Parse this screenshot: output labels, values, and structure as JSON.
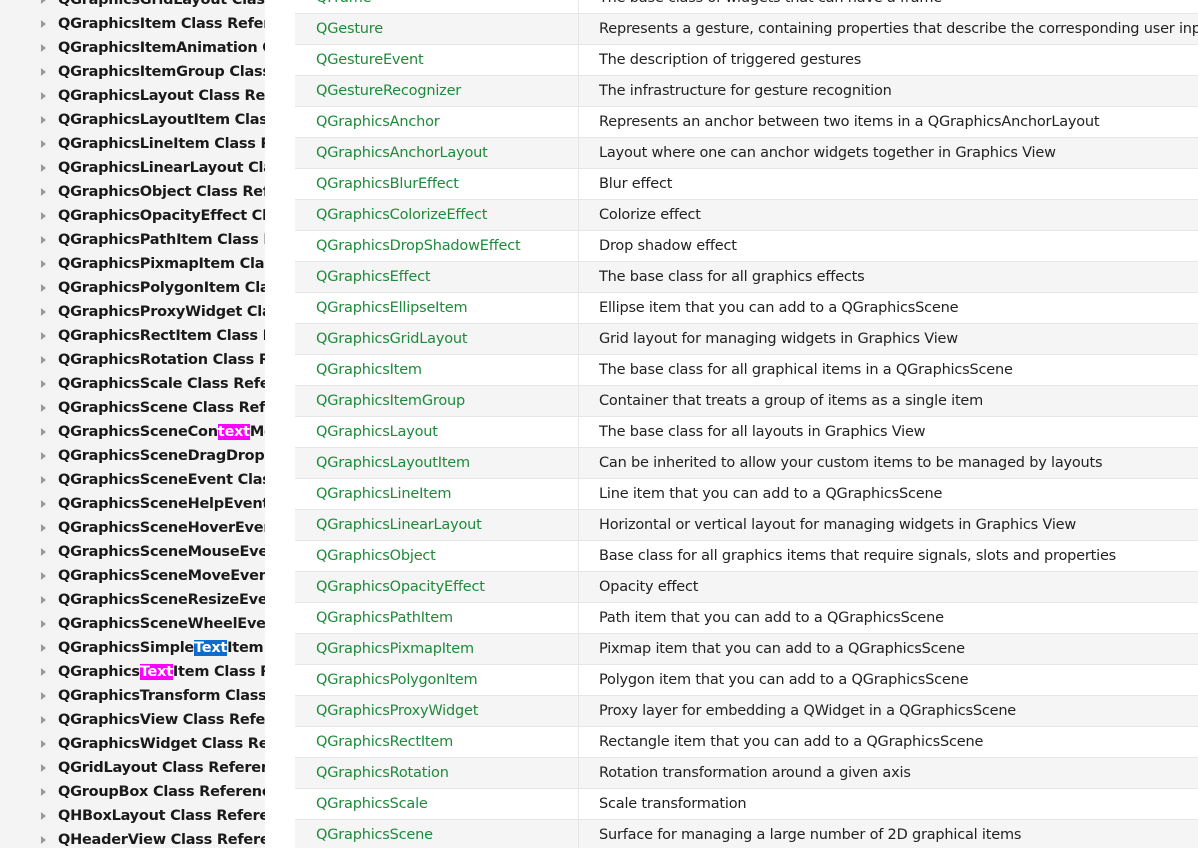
{
  "sidebar": {
    "items": [
      {
        "label": "QGraphicsGridLayout Class Reference"
      },
      {
        "label": "QGraphicsItem Class Reference"
      },
      {
        "label": "QGraphicsItemAnimation Class Reference"
      },
      {
        "label": "QGraphicsItemGroup Class Reference"
      },
      {
        "label": "QGraphicsLayout Class Reference"
      },
      {
        "label": "QGraphicsLayoutItem Class Reference"
      },
      {
        "label": "QGraphicsLineItem Class Reference"
      },
      {
        "label": "QGraphicsLinearLayout Class Reference"
      },
      {
        "label": "QGraphicsObject Class Reference"
      },
      {
        "label": "QGraphicsOpacityEffect Class Reference"
      },
      {
        "label": "QGraphicsPathItem Class Reference"
      },
      {
        "label": "QGraphicsPixmapItem Class Reference"
      },
      {
        "label": "QGraphicsPolygonItem Class Reference"
      },
      {
        "label": "QGraphicsProxyWidget Class Reference"
      },
      {
        "label": "QGraphicsRectItem Class Reference"
      },
      {
        "label": "QGraphicsRotation Class Reference"
      },
      {
        "label": "QGraphicsScale Class Reference"
      },
      {
        "label": "QGraphicsScene Class Reference"
      },
      {
        "label": "QGraphicsSceneContextMenuEvent Class Reference",
        "pre": "QGraphicsSceneCon",
        "hl": "text",
        "post": "MenuEvent Class Reference",
        "hl_color": "pink"
      },
      {
        "label": "QGraphicsSceneDragDropEvent Class Reference"
      },
      {
        "label": "QGraphicsSceneEvent Class Reference"
      },
      {
        "label": "QGraphicsSceneHelpEvent Class Reference"
      },
      {
        "label": "QGraphicsSceneHoverEvent Class Reference"
      },
      {
        "label": "QGraphicsSceneMouseEvent Class Reference"
      },
      {
        "label": "QGraphicsSceneMoveEvent Class Reference"
      },
      {
        "label": "QGraphicsSceneResizeEvent Class Reference"
      },
      {
        "label": "QGraphicsSceneWheelEvent Class Reference"
      },
      {
        "label": "QGraphicsSimpleTextItem Class Reference",
        "pre": "QGraphicsSimple",
        "hl": "Text",
        "post": "Item Class Reference",
        "hl_color": "blue"
      },
      {
        "label": "QGraphicsTextItem Class Reference",
        "pre": "QGraphics",
        "hl": "Text",
        "post": "Item Class Reference",
        "hl_color": "pink"
      },
      {
        "label": "QGraphicsTransform Class Reference"
      },
      {
        "label": "QGraphicsView Class Reference"
      },
      {
        "label": "QGraphicsWidget Class Reference"
      },
      {
        "label": "QGridLayout Class Reference"
      },
      {
        "label": "QGroupBox Class Reference"
      },
      {
        "label": "QHBoxLayout Class Reference"
      },
      {
        "label": "QHeaderView Class Reference"
      }
    ]
  },
  "table": {
    "rows": [
      {
        "name": "QFrame",
        "desc": "The base class of widgets that can have a frame"
      },
      {
        "name": "QGesture",
        "desc": "Represents a gesture, containing properties that describe the corresponding user input"
      },
      {
        "name": "QGestureEvent",
        "desc": "The description of triggered gestures"
      },
      {
        "name": "QGestureRecognizer",
        "desc": "The infrastructure for gesture recognition"
      },
      {
        "name": "QGraphicsAnchor",
        "desc": "Represents an anchor between two items in a QGraphicsAnchorLayout"
      },
      {
        "name": "QGraphicsAnchorLayout",
        "desc": "Layout where one can anchor widgets together in Graphics View"
      },
      {
        "name": "QGraphicsBlurEffect",
        "desc": "Blur effect"
      },
      {
        "name": "QGraphicsColorizeEffect",
        "desc": "Colorize effect"
      },
      {
        "name": "QGraphicsDropShadowEffect",
        "desc": "Drop shadow effect"
      },
      {
        "name": "QGraphicsEffect",
        "desc": "The base class for all graphics effects"
      },
      {
        "name": "QGraphicsEllipseItem",
        "desc": "Ellipse item that you can add to a QGraphicsScene"
      },
      {
        "name": "QGraphicsGridLayout",
        "desc": "Grid layout for managing widgets in Graphics View"
      },
      {
        "name": "QGraphicsItem",
        "desc": "The base class for all graphical items in a QGraphicsScene"
      },
      {
        "name": "QGraphicsItemGroup",
        "desc": "Container that treats a group of items as a single item"
      },
      {
        "name": "QGraphicsLayout",
        "desc": "The base class for all layouts in Graphics View"
      },
      {
        "name": "QGraphicsLayoutItem",
        "desc": "Can be inherited to allow your custom items to be managed by layouts"
      },
      {
        "name": "QGraphicsLineItem",
        "desc": "Line item that you can add to a QGraphicsScene"
      },
      {
        "name": "QGraphicsLinearLayout",
        "desc": "Horizontal or vertical layout for managing widgets in Graphics View"
      },
      {
        "name": "QGraphicsObject",
        "desc": "Base class for all graphics items that require signals, slots and properties"
      },
      {
        "name": "QGraphicsOpacityEffect",
        "desc": "Opacity effect"
      },
      {
        "name": "QGraphicsPathItem",
        "desc": "Path item that you can add to a QGraphicsScene"
      },
      {
        "name": "QGraphicsPixmapItem",
        "desc": "Pixmap item that you can add to a QGraphicsScene"
      },
      {
        "name": "QGraphicsPolygonItem",
        "desc": "Polygon item that you can add to a QGraphicsScene"
      },
      {
        "name": "QGraphicsProxyWidget",
        "desc": "Proxy layer for embedding a QWidget in a QGraphicsScene"
      },
      {
        "name": "QGraphicsRectItem",
        "desc": "Rectangle item that you can add to a QGraphicsScene"
      },
      {
        "name": "QGraphicsRotation",
        "desc": "Rotation transformation around a given axis"
      },
      {
        "name": "QGraphicsScale",
        "desc": "Scale transformation"
      },
      {
        "name": "QGraphicsScene",
        "desc": "Surface for managing a large number of 2D graphical items"
      }
    ]
  },
  "colors": {
    "link_green": "#1e8a3a",
    "highlight_pink": "#ff00ff",
    "highlight_blue": "#0a6bd1"
  }
}
